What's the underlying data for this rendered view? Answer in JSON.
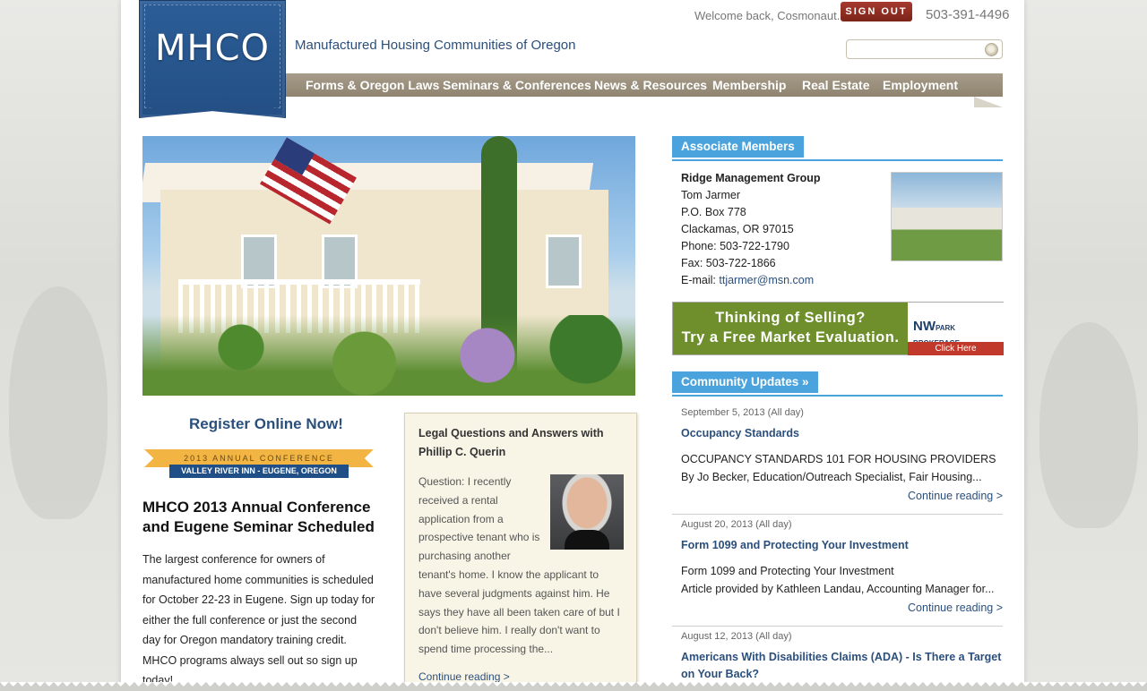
{
  "site": {
    "logo_text": "MHCO",
    "tagline": "Manufactured Housing Communities of Oregon"
  },
  "header": {
    "welcome": "Welcome back, Cosmonaut.",
    "signout_label": "SIGN OUT",
    "phone": "503-391-4496",
    "search_placeholder": ""
  },
  "nav": {
    "items": [
      {
        "label": "Forms & Oregon Laws"
      },
      {
        "label": "Seminars & Conferences"
      },
      {
        "label": "News & Resources"
      },
      {
        "label": "Membership"
      },
      {
        "label": "Real Estate"
      },
      {
        "label": "Employment"
      }
    ]
  },
  "featured": {
    "register_label": "Register Online Now!",
    "banner_top": "2013 ANNUAL CONFERENCE",
    "banner_bottom": "VALLEY RIVER INN  -  EUGENE, OREGON",
    "title": "MHCO 2013 Annual Conference and Eugene Seminar Scheduled",
    "body": "The largest conference for owners of manufactured home communities is scheduled for October 22-23 in Eugene. Sign up today for either the full conference or just the second day for Oregon mandatory training credit. MHCO programs always sell out so sign up today!."
  },
  "legal": {
    "title": "Legal Questions and Answers with Phillip C. Querin",
    "body_short": "Question: I recently received a rental application from a prospective tenant who is purchasing another",
    "body_rest": "tenant's home. I know the applicant to have several judgments against him. He says they have all been taken care of but I don't believe him. I really don't want to spend time processing the...",
    "more": "Continue reading >"
  },
  "associate": {
    "heading": "Associate Members",
    "company": "Ridge Management Group",
    "contact": "Tom Jarmer",
    "address1": "P.O. Box 778",
    "address2": "Clackamas, OR 97015",
    "phone": "Phone: 503-722-1790",
    "fax": "Fax: 503-722-1866",
    "email_label": "E-mail: ",
    "email": "ttjarmer@msn.com"
  },
  "ad": {
    "line1": "Thinking of Selling?",
    "line2": "Try a Free Market Evaluation.",
    "brand": "NW",
    "brand_sub": "PARK BROKERAGE",
    "cta": "Click Here"
  },
  "updates": {
    "heading": "Community Updates »",
    "items": [
      {
        "date": "September 5, 2013 (All day)",
        "title": "Occupancy Standards",
        "sub1": "OCCUPANCY STANDARDS 101 FOR HOUSING PROVIDERS",
        "sub2": "By Jo Becker, Education/Outreach Specialist, Fair Housing...",
        "more": "Continue reading >"
      },
      {
        "date": "August 20, 2013 (All day)",
        "title": "Form 1099 and Protecting Your Investment",
        "sub1": "Form 1099 and Protecting Your Investment",
        "sub2": "Article provided by Kathleen Landau, Accounting Manager for...",
        "more": "Continue reading >"
      },
      {
        "date": "August 12, 2013 (All day)",
        "title": "Americans With Disabilities Claims (ADA) - Is There a Target on Your Back?"
      }
    ]
  }
}
